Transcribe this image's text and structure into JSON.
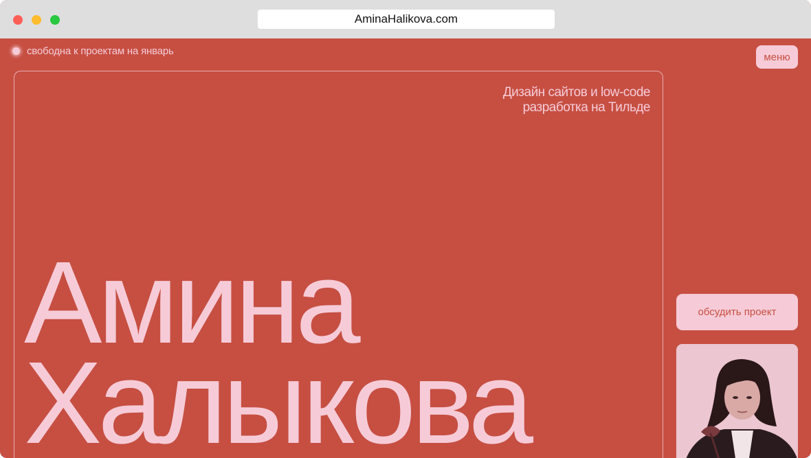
{
  "browser": {
    "url": "AminaHalikova.com"
  },
  "header": {
    "status_text": "свободна к проектам на январь",
    "menu_label": "меню"
  },
  "hero": {
    "tagline_line1": "Дизайн сайтов и low-code",
    "tagline_line2": "разработка на Тильде",
    "first_name": "Амина",
    "last_name": "Халыкова"
  },
  "sidebar": {
    "cta_label": "обсудить проект"
  },
  "colors": {
    "background": "#c64f42",
    "accent_pink": "#f6cbd7",
    "titlebar": "#dedede"
  }
}
